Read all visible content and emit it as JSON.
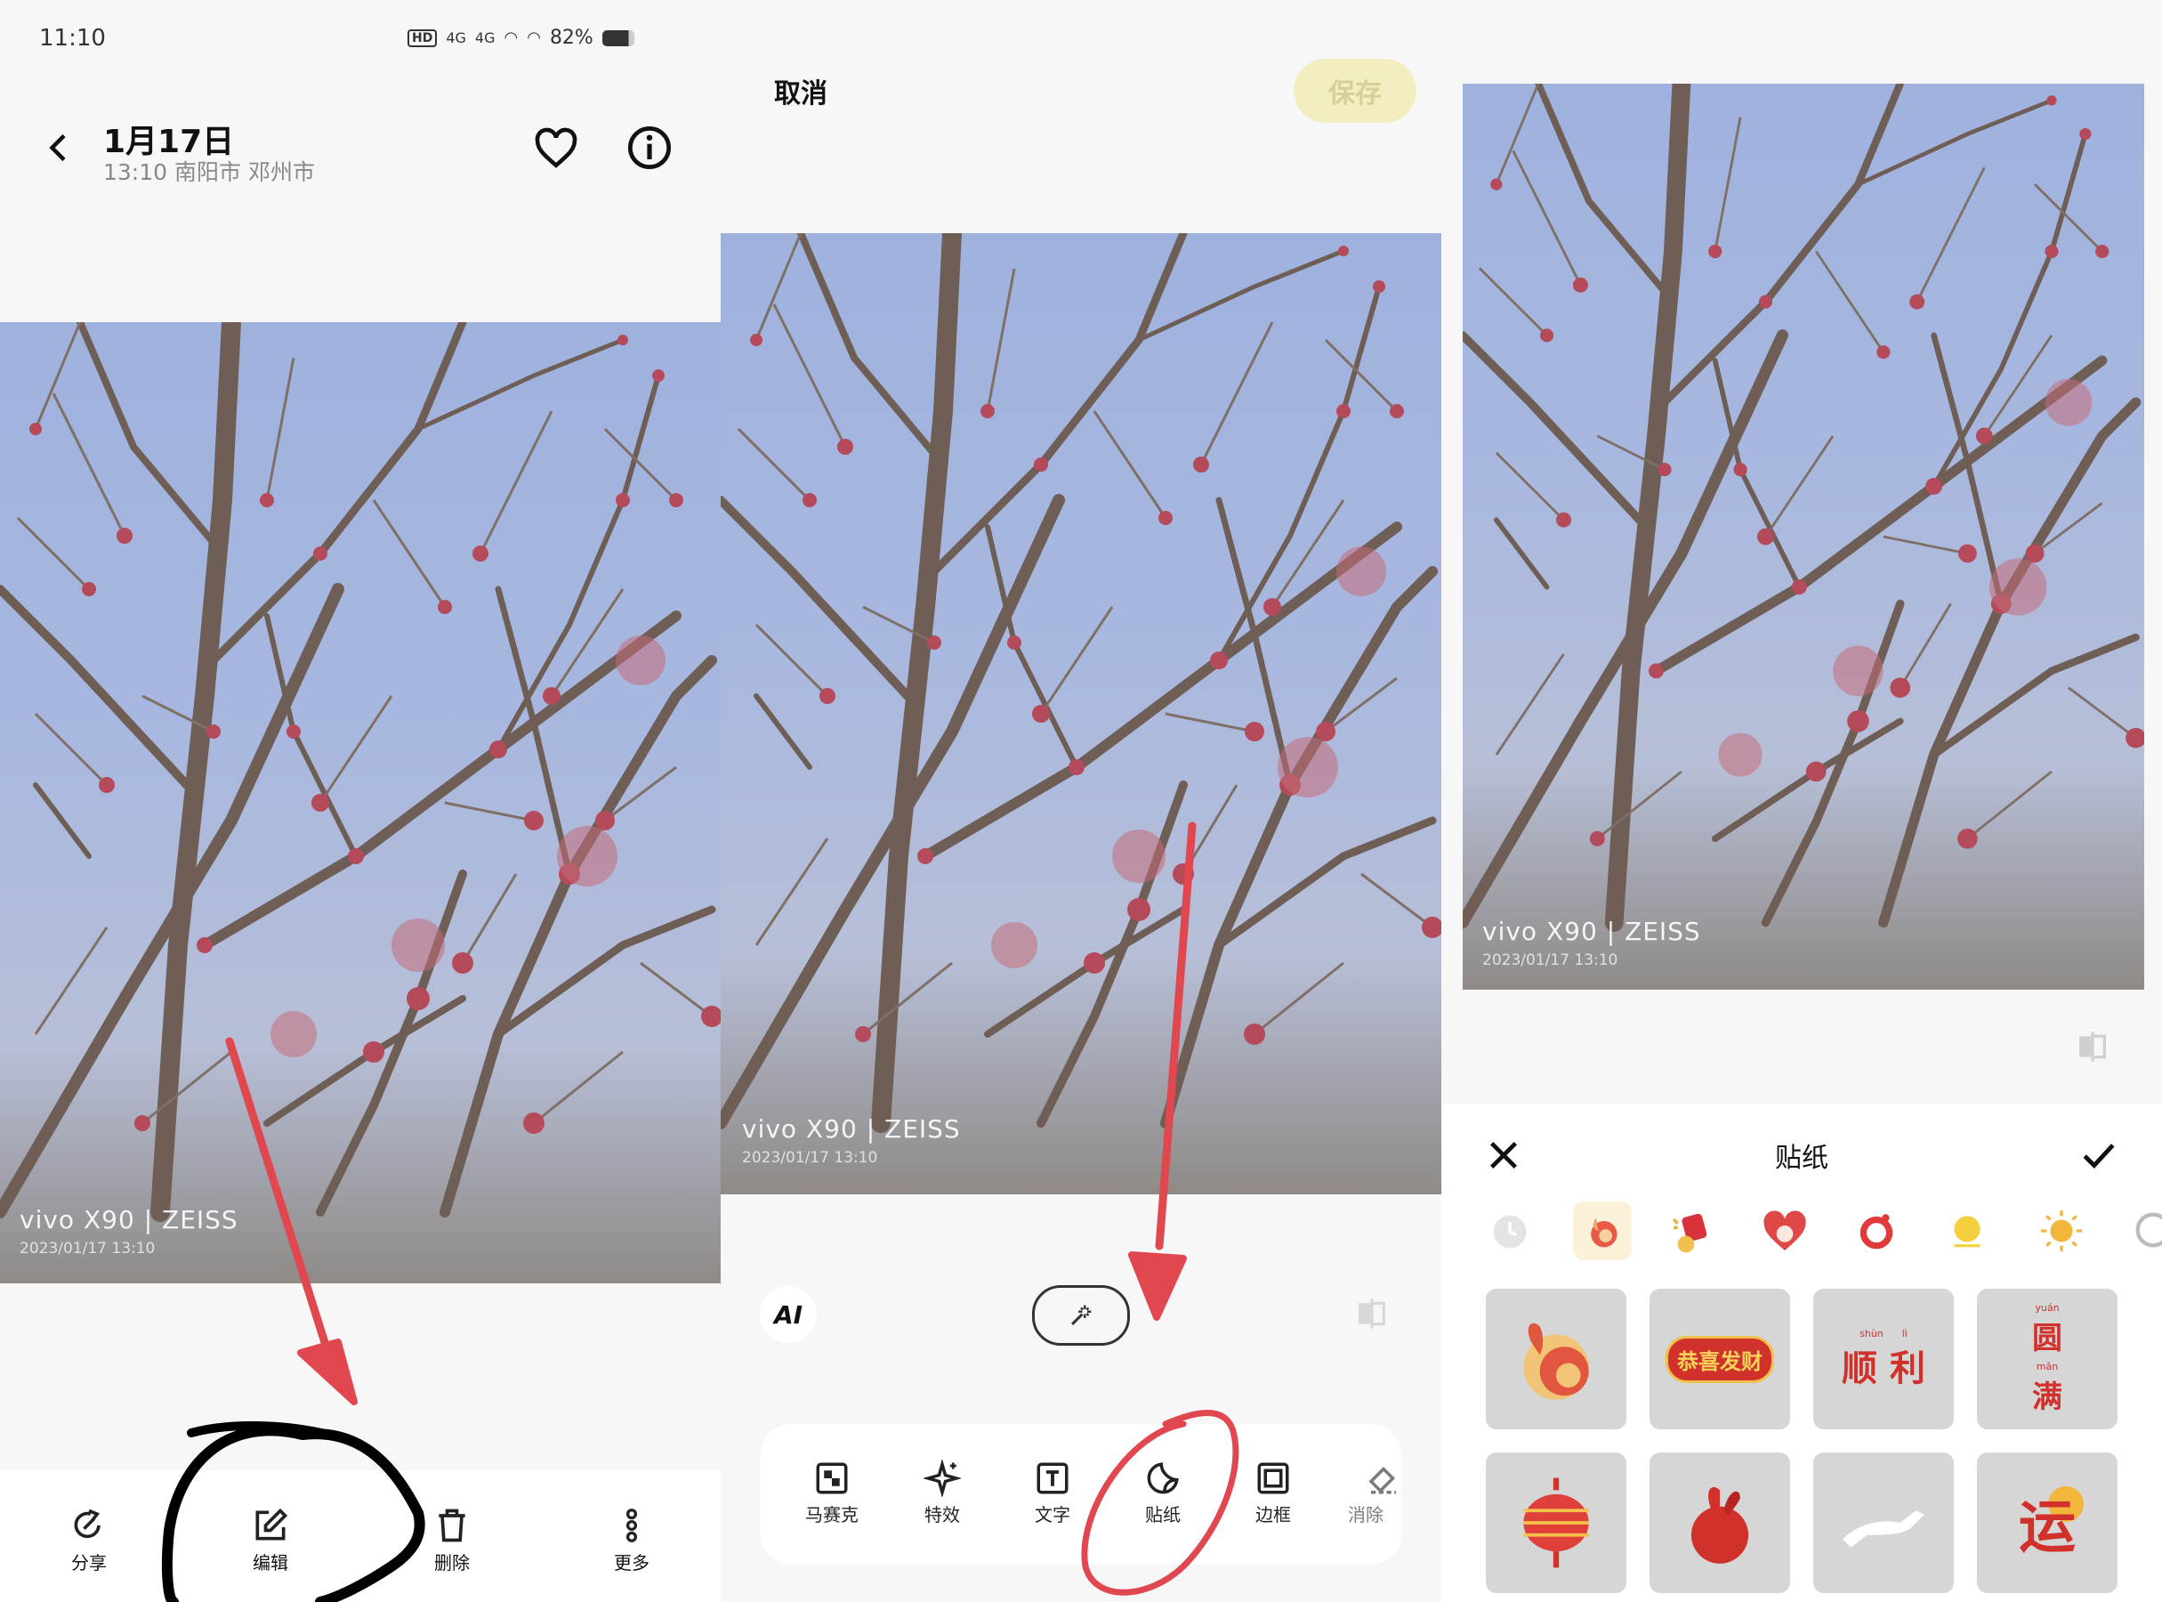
{
  "status_bar": {
    "time": "11:10",
    "hd_label": "HD",
    "net1": "4G",
    "net2": "4G",
    "battery": "82%"
  },
  "viewer": {
    "date_title": "1月17日",
    "subtitle": "13:10 南阳市 邓州市",
    "actions": [
      {
        "label": "分享",
        "icon": "share-icon"
      },
      {
        "label": "编辑",
        "icon": "edit-icon"
      },
      {
        "label": "删除",
        "icon": "delete-icon"
      },
      {
        "label": "更多",
        "icon": "more-icon"
      }
    ]
  },
  "watermark": {
    "brand": "vivo",
    "model": "X90",
    "sep": "|",
    "lens": "ZEISS",
    "date": "2023/01/17 13:10"
  },
  "editor": {
    "cancel_label": "取消",
    "save_label": "保存",
    "ai_label": "AI",
    "tools": [
      {
        "label": "马赛克",
        "icon": "mosaic-icon"
      },
      {
        "label": "特效",
        "icon": "effects-icon"
      },
      {
        "label": "文字",
        "icon": "text-icon"
      },
      {
        "label": "贴纸",
        "icon": "sticker-icon"
      },
      {
        "label": "边框",
        "icon": "frame-icon"
      },
      {
        "label": "消除",
        "icon": "eraser-icon"
      }
    ]
  },
  "sticker_panel": {
    "title": "贴纸",
    "categories": [
      "recent-clock-icon",
      "rabbit-category-icon",
      "lucky-bag-icon",
      "heart-rabbit-icon",
      "red-ring-icon",
      "sunny-chick-icon",
      "sun-icon",
      "more-category-icon"
    ],
    "stickers": [
      {
        "name": "rabbit-moon-sticker",
        "text": ""
      },
      {
        "name": "gongxi-facai-sticker",
        "text": "恭喜发财"
      },
      {
        "name": "shunli-sticker",
        "text": "顺 利",
        "pinyin": "shùn      lì"
      },
      {
        "name": "yuanman-sticker",
        "text_top": "圆",
        "text_bottom": "满",
        "pinyin_top": "yuán",
        "pinyin_bottom": "mǎn"
      },
      {
        "name": "lantern-sticker",
        "text": ""
      },
      {
        "name": "red-rabbit-sticker",
        "text": ""
      },
      {
        "name": "white-rabbit-sticker",
        "text": ""
      },
      {
        "name": "yun-sticker",
        "text": "运"
      }
    ]
  },
  "colors": {
    "annotation_red": "#e0474f",
    "save_bg": "#f3eec0",
    "sticker_red": "#d1312b"
  }
}
